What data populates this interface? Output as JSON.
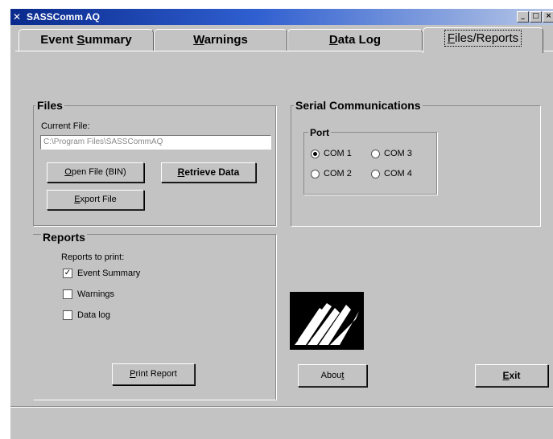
{
  "window": {
    "title": "SASSComm AQ",
    "icon_name": "app-icon",
    "controls": [
      "_",
      "□",
      "×"
    ]
  },
  "tabs": [
    {
      "prefix": "Event ",
      "key": "S",
      "suffix": "ummary"
    },
    {
      "prefix": "",
      "key": "W",
      "suffix": "arnings"
    },
    {
      "prefix": "",
      "key": "D",
      "suffix": "ata Log"
    },
    {
      "prefix": "",
      "key": "F",
      "suffix": "iles/Reports"
    }
  ],
  "files": {
    "legend": "Files",
    "current_file_label": "Current File:",
    "current_file_value": "C:\\Program Files\\SASSCommAQ",
    "open_button": {
      "key": "O",
      "suffix": "pen File (BIN)"
    },
    "retrieve_button": {
      "key": "R",
      "suffix": "etrieve Data"
    },
    "export_button": {
      "key": "E",
      "suffix": "xport File"
    }
  },
  "serial": {
    "legend": "Serial Communications",
    "port_legend": "Port",
    "ports": [
      "COM 1",
      "COM 3",
      "COM 2",
      "COM 4"
    ],
    "selected": "COM 1"
  },
  "reports": {
    "legend": "Reports",
    "to_print_label": "Reports to print:",
    "options": [
      {
        "label": "Event Summary",
        "checked": true
      },
      {
        "label": "Warnings",
        "checked": false
      },
      {
        "label": "Data log",
        "checked": false
      }
    ],
    "print_button": {
      "key": "P",
      "suffix": "rint Report"
    }
  },
  "about_button": {
    "prefix": "Abou",
    "key": "t"
  },
  "exit_button": {
    "key": "E",
    "suffix": "xit"
  },
  "colors": {
    "face": "#c3c3c3",
    "title_start": "#0a2a8c",
    "title_end": "#b7c7e6"
  }
}
